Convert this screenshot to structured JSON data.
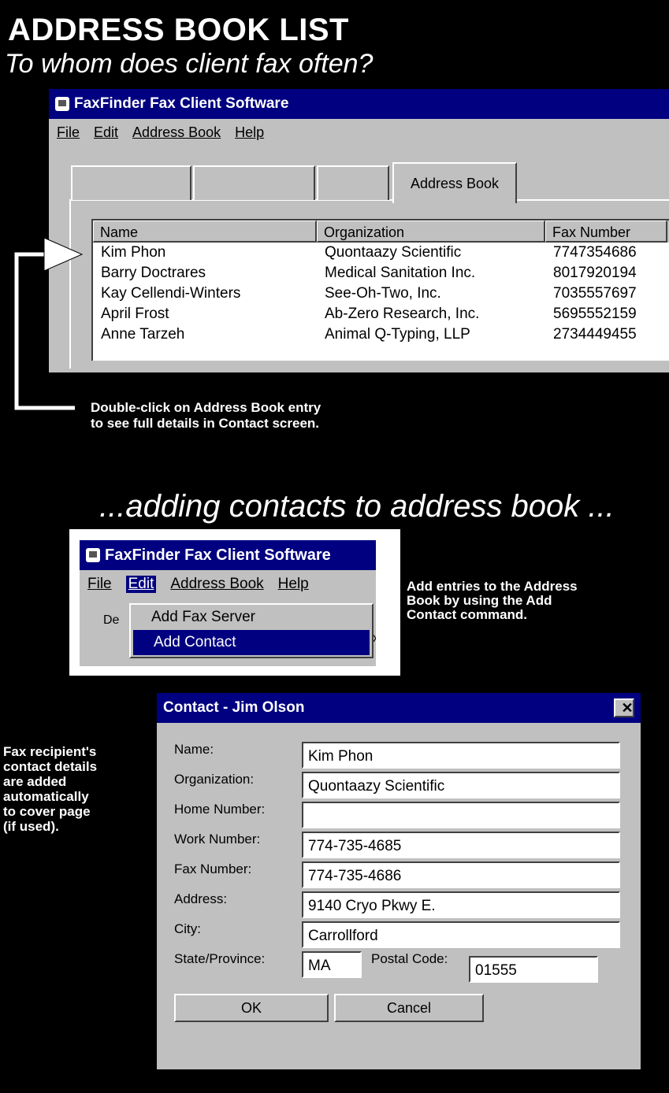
{
  "heading": {
    "title": "ADDRESS BOOK LIST",
    "subtitle": "To whom does client fax often?"
  },
  "window1": {
    "title": "FaxFinder Fax Client Software",
    "menu": [
      "File",
      "Edit",
      "Address Book",
      "Help"
    ],
    "active_tab": "Address Book",
    "columns": [
      "Name",
      "Organization",
      "Fax Number"
    ],
    "rows": [
      {
        "name": "Kim Phon",
        "org": "Quontaazy Scientific",
        "fax": "7747354686"
      },
      {
        "name": "Barry Doctrares",
        "org": "Medical Sanitation Inc.",
        "fax": "8017920194"
      },
      {
        "name": "Kay Cellendi-Winters",
        "org": "See-Oh-Two, Inc.",
        "fax": "7035557697"
      },
      {
        "name": "April Frost",
        "org": "Ab-Zero Research, Inc.",
        "fax": "5695552159"
      },
      {
        "name": "Anne Tarzeh",
        "org": "Animal Q-Typing, LLP",
        "fax": "2734449455"
      }
    ]
  },
  "annotation1": {
    "line1": "Double-click on Address Book entry",
    "line2": "to see full details in Contact screen."
  },
  "subheading": "...adding contacts to address book ...",
  "window2": {
    "title": "FaxFinder Fax Client Software",
    "menu": [
      "File",
      "Edit",
      "Address Book",
      "Help"
    ],
    "dropdown": [
      "Add Fax Server",
      "Add Contact"
    ],
    "partial_left": "De",
    "partial_right": "x"
  },
  "annotation2": {
    "line1": "Add entries to the Address",
    "line2": "Book by  using the Add",
    "line3": "Contact command."
  },
  "contact_dialog": {
    "title": "Contact - Jim Olson",
    "close": "✕",
    "name_label": "Name:",
    "name_value": "Kim Phon",
    "org_label": "Organization:",
    "org_value": "Quontaazy Scientific",
    "home_label": "Home Number:",
    "home_value": "",
    "work_label": "Work Number:",
    "work_value": "774-735-4685",
    "fax_label": "Fax Number:",
    "fax_value": "774-735-4686",
    "address_label": "Address:",
    "address_value": "9140 Cryo Pkwy E.",
    "city_label": "City:",
    "city_value": "Carrollford",
    "state_label": "State/Province:",
    "state_value": "MA",
    "postal_label": "Postal Code:",
    "postal_value": "01555",
    "ok_label": "OK",
    "cancel_label": "Cancel"
  },
  "annotation3": {
    "lines": [
      "Fax recipient's",
      "contact details",
      "are added",
      "automatically",
      "to cover page",
      "(if used)."
    ]
  }
}
